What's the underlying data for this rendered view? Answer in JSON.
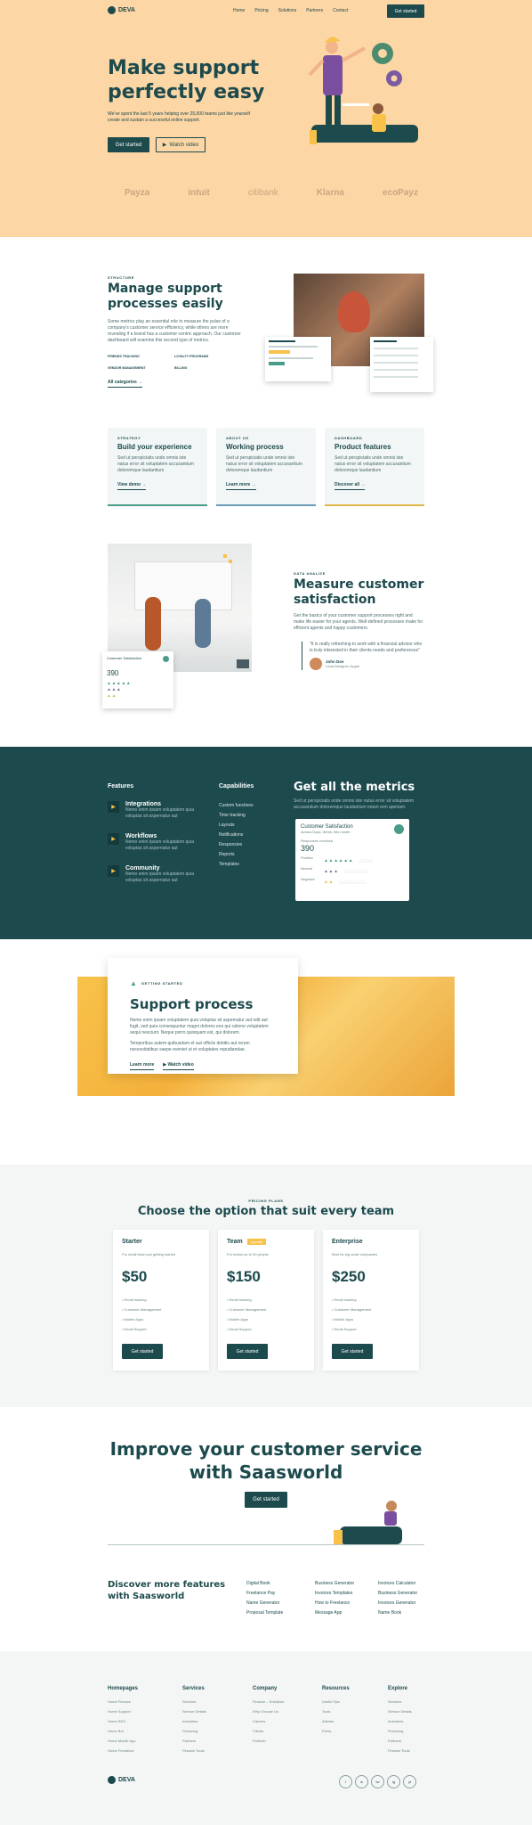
{
  "nav": {
    "logo": "DEVA",
    "items": [
      "Home",
      "Pricing",
      "Solutions",
      "Partners",
      "Contact"
    ],
    "cta": "Get started"
  },
  "hero": {
    "title_line1": "Make support",
    "title_line2": "perfectly easy",
    "subtitle": "We've spent the last 5 years helping over 25,000 teams just like yourself create and sustain a successful online support.",
    "primary": "Get started",
    "secondary": "Watch video",
    "logos": [
      "Payza",
      "intuit",
      "citibank",
      "Klarna",
      "ecoPayz"
    ]
  },
  "structure": {
    "eyebrow": "STRUCTURE",
    "title_line1": "Manage support",
    "title_line2": "processes easily",
    "body": "Some metrics play an essential role to measure the pulse of a company's customer service efficiency, while others are more revealing if a brand has a customer-centric approach. Our customer dashboard will examine this second type of metrics.",
    "tags": [
      "FRIENDS TRACKING",
      "LOYALTY PROGRAMS",
      "VENDOR MANAGEMENT",
      "BILLING"
    ],
    "link": "All categories"
  },
  "cards": [
    {
      "eyebrow": "STRATEGY",
      "title": "Build your experience",
      "body": "Sed ut perspiciatis unde omnis iste natus error sit voluptatem accusantium doloremque laudantium",
      "link": "View demo"
    },
    {
      "eyebrow": "ABOUT US",
      "title": "Working process",
      "body": "Sed ut perspiciatis unde omnis iste natus error sit voluptatem accusantium doloremque laudantium",
      "link": "Learn more"
    },
    {
      "eyebrow": "DASHBOARD",
      "title": "Product features",
      "body": "Sed ut perspiciatis unde omnis iste natus error sit voluptatem accusantium doloremque laudantium",
      "link": "Discover all"
    }
  ],
  "data": {
    "eyebrow": "DATA ANALIZE",
    "title_line1": "Measure customer",
    "title_line2": "satisfaction",
    "body": "Get the basics of your customer support processes right and make life easier for your agents. Well-defined processes make for efficient agents and happy customers.",
    "quote": "\"It is really refreshing to work with a financial advisor who is truly interested in their clients needs and preferences\"",
    "author": "John Doe",
    "role": "Lead Designer, Apple",
    "widget_title": "Customer Satisfaction",
    "widget_value": "390"
  },
  "metrics": {
    "features_title": "Features",
    "features": [
      {
        "title": "Integrations",
        "body": "Nemo enim ipsam voluptatem quia voluptas sit aspernatur aut"
      },
      {
        "title": "Workflows",
        "body": "Nemo enim ipsam voluptatem quia voluptas sit aspernatur aut"
      },
      {
        "title": "Community",
        "body": "Nemo enim ipsam voluptatem quia voluptas sit aspernatur aut"
      }
    ],
    "cap_title": "Capabilities",
    "caps": [
      "Custom functions",
      "Time tracking",
      "Layouts",
      "Notifications",
      "Responsive",
      "Reports",
      "Templates"
    ],
    "title": "Get all the metrics",
    "body": "Sed ut perspiciatis unde omnis iste natus error sit voluptatem accusantium doloremque laudantium totam rem aperiam.",
    "widget_title": "Customer Satisfaction",
    "widget_sub": "Across Days, Week, this month",
    "widget_label": "Responses received",
    "widget_value": "390",
    "rows": [
      "Positive",
      "Neutral",
      "Negative"
    ]
  },
  "process": {
    "eyebrow": "GETTING STARTED",
    "title": "Support process",
    "p1": "Nemo enim ipsam voluptatem quia voluptas sit aspernatur aut odit aut fugit, sed quia consequuntur magni dolores eos qui ratione voluptatem sequi nesciunt. Neque porro quisquam est, qui dolorem.",
    "p2": "Temporibus autem quibusdam et aut officiis debitis aut rerum necessitatibus saepe eveniet ut et voluptates repudiandae.",
    "link1": "Learn more",
    "link2": "Watch video"
  },
  "pricing": {
    "eyebrow": "PRICING PLANS",
    "title": "Choose the option that suit every team",
    "plans": [
      {
        "name": "Starter",
        "badge": "",
        "desc": "For small team just getting started",
        "price": "$50",
        "features": [
          "Email tracking",
          "Customer Management",
          "Mobile Apps",
          "Email Support"
        ],
        "cta": "Get started"
      },
      {
        "name": "Team",
        "badge": "popular",
        "desc": "For teams up to 30 people",
        "price": "$150",
        "features": [
          "Email tracking",
          "Customer Management",
          "Mobile Apps",
          "Email Support"
        ],
        "cta": "Get started"
      },
      {
        "name": "Enterprise",
        "badge": "",
        "desc": "Best for big scale companies",
        "price": "$250",
        "features": [
          "Email tracking",
          "Customer Management",
          "Mobile Apps",
          "Email Support"
        ],
        "cta": "Get started"
      }
    ]
  },
  "cta": {
    "title_line1": "Improve your customer service",
    "title_line2": "with Saasworld",
    "button": "Get started"
  },
  "discover": {
    "title_line1": "Discover more features",
    "title_line2": "with Saasworld",
    "cols": [
      [
        "Digital Book",
        "Freelance Pay",
        "Name Generator",
        "Proposal Template"
      ],
      [
        "Business Generator",
        "Invoices Templates",
        "How to Freelance",
        "Message App"
      ],
      [
        "Invoices Calculator",
        "Business Generator",
        "Invoices Generator",
        "Name Book"
      ]
    ]
  },
  "footer": {
    "cols": [
      {
        "title": "Homepages",
        "items": [
          "Home Finance",
          "Home Support",
          "Home SEO",
          "Home Bot",
          "Home Mobile App",
          "Home Freelance"
        ]
      },
      {
        "title": "Services",
        "items": [
          "Services",
          "Service Details",
          "Industries",
          "Financing",
          "Partners",
          "Finance Tools"
        ]
      },
      {
        "title": "Company",
        "items": [
          "Finance – Solutions",
          "Why Choose Us",
          "Careers",
          "Clients",
          "Portfolio"
        ]
      },
      {
        "title": "Resources",
        "items": [
          "Useful Tips",
          "Tools",
          "Articles",
          "Press"
        ]
      },
      {
        "title": "Explore",
        "items": [
          "Services",
          "Service Details",
          "Industries",
          "Financing",
          "Partners",
          "Finance Tools"
        ]
      }
    ],
    "logo": "DEVA",
    "social": [
      "f",
      "in",
      "tw",
      "ig",
      "yt"
    ]
  },
  "colors": {
    "peach": "#fcd6a5",
    "teal": "#1d4a4d",
    "yellow": "#f8c24a",
    "gray": "#f4f6f6"
  }
}
